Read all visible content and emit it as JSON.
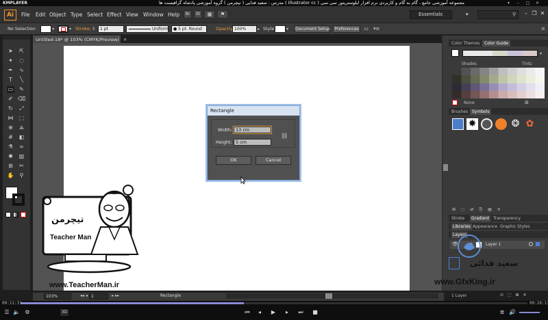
{
  "player": {
    "name": "KMPLAYER",
    "title": "مجموعه آموزشی جامع ، گام به گام و کاربردی نرم افزار ایلوستریتور سی سی ( Illustrator cc ) مدرس : سعید فدایی ( تیچرمن ) گروه آموزشی پادشاه گرافیست ها",
    "time_current": "00:11:31",
    "time_total": "00:26:13",
    "progress": 0.44
  },
  "menu": {
    "logo": "Ai",
    "items": [
      "File",
      "Edit",
      "Object",
      "Type",
      "Select",
      "Effect",
      "View",
      "Window",
      "Help"
    ],
    "workspace": "Essentials"
  },
  "control_bar": {
    "selection": "No Selection",
    "stroke_label": "Stroke:",
    "stroke_weight": "1 pt",
    "profile": "Uniform",
    "brush": "5 pt. Round",
    "opacity_label": "Opacity:",
    "opacity": "100%",
    "style_label": "Style:",
    "doc_setup": "Document Setup",
    "preferences": "Preferences"
  },
  "document": {
    "tab": "Untitled-18* @ 103% (CMYK/Preview)"
  },
  "dialog": {
    "title": "Rectangle",
    "width_label": "Width:",
    "width_value": "13 cm",
    "height_label": "Height:",
    "height_value": "5 cm",
    "ok": "OK",
    "cancel": "Cancel"
  },
  "panels": {
    "color_tabs": [
      "Color Themes",
      "Color Guide"
    ],
    "shades": "Shades",
    "tints": "Tints",
    "none": "None",
    "brush_tabs": [
      "Brushes",
      "Symbols"
    ],
    "stroke_tabs": [
      "Stroke",
      "Gradient",
      "Transparency"
    ],
    "lib_tabs": [
      "Libraries",
      "Appearance",
      "Graphic Styles"
    ],
    "layers_title": "Layers",
    "layer_name": "Layer 1",
    "layer_count": "1 Layer"
  },
  "status": {
    "zoom": "103%",
    "page": "1",
    "tool": "Rectangle"
  },
  "watermarks": {
    "teacher_url": "www.TeacherMan.ir",
    "teacher_logo_fa": "تیچرمن",
    "teacher_logo_en": "Teacher Man",
    "gfx_url": "www.GfxKing.ir",
    "name_fa": "سعید فدائی"
  },
  "colors": {
    "ai_orange": "#f39a2c",
    "dialog_title": "#d7e3f1",
    "accent_blue": "#5d8fd6"
  }
}
